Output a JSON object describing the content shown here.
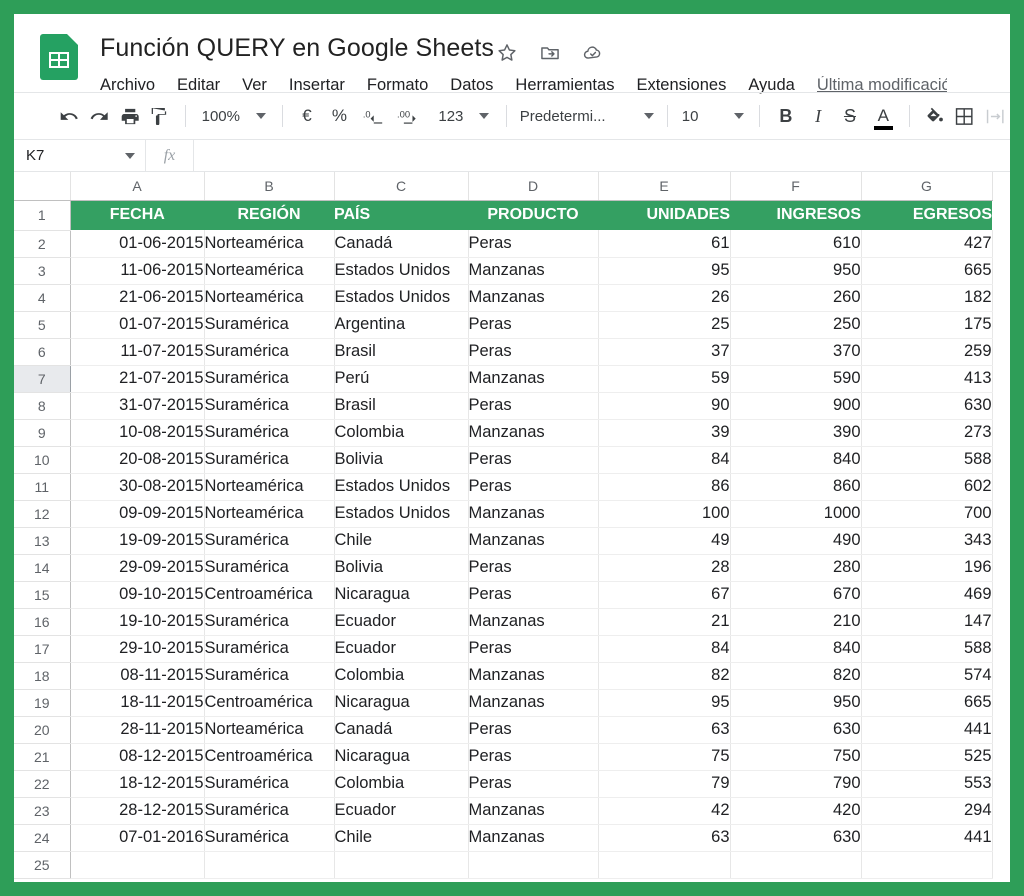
{
  "app": {
    "logo_name": "google-sheets-logo",
    "accent_green": "#34a062",
    "frame_green": "#2e9e58"
  },
  "titlebar": {
    "document_title": "Función QUERY en Google Sheets",
    "icons": [
      {
        "name": "star-icon",
        "label": "Destacar"
      },
      {
        "name": "move-to-folder-icon",
        "label": "Mover"
      },
      {
        "name": "cloud-saved-icon",
        "label": "Guardado en Drive"
      }
    ]
  },
  "menubar": {
    "items": [
      {
        "label": "Archivo"
      },
      {
        "label": "Editar"
      },
      {
        "label": "Ver"
      },
      {
        "label": "Insertar"
      },
      {
        "label": "Formato"
      },
      {
        "label": "Datos"
      },
      {
        "label": "Herramientas"
      },
      {
        "label": "Extensiones"
      },
      {
        "label": "Ayuda"
      }
    ],
    "last_modified": "Última modificació"
  },
  "toolbar": {
    "undo": "undo-icon",
    "redo": "redo-icon",
    "print": "print-icon",
    "paint_format": "paint-format-icon",
    "zoom_value": "100%",
    "currency": "€",
    "percent": "%",
    "decrease_decimal": ".0",
    "increase_decimal": ".00",
    "number_format": "123",
    "font_value": "Predetermi...",
    "font_size_value": "10",
    "bold": "B",
    "italic": "I",
    "strikethrough": "S",
    "text_color": "A",
    "fill_color": "fill-color-icon",
    "borders": "borders-icon",
    "merge_cells": "merge-cells-icon"
  },
  "formulabar": {
    "name_box_value": "K7",
    "fx_label": "fx",
    "formula_value": ""
  },
  "grid": {
    "columns": [
      "A",
      "B",
      "C",
      "D",
      "E",
      "F",
      "G"
    ],
    "headers": [
      "FECHA",
      "REGIÓN",
      "PAÍS",
      "PRODUCTO",
      "UNIDADES",
      "INGRESOS",
      "EGRESOS"
    ],
    "header_aligns": [
      "center",
      "center",
      "left",
      "center",
      "right",
      "right",
      "right"
    ],
    "col_aligns": [
      "right",
      "left",
      "left",
      "left",
      "right",
      "right",
      "right"
    ],
    "header_row_number": "1",
    "selected_row": "7",
    "rows": [
      {
        "n": "2",
        "cells": [
          "01-06-2015",
          "Norteamérica",
          "Canadá",
          "Peras",
          "61",
          "610",
          "427"
        ]
      },
      {
        "n": "3",
        "cells": [
          "11-06-2015",
          "Norteamérica",
          "Estados Unidos",
          "Manzanas",
          "95",
          "950",
          "665"
        ]
      },
      {
        "n": "4",
        "cells": [
          "21-06-2015",
          "Norteamérica",
          "Estados Unidos",
          "Manzanas",
          "26",
          "260",
          "182"
        ]
      },
      {
        "n": "5",
        "cells": [
          "01-07-2015",
          "Suramérica",
          "Argentina",
          "Peras",
          "25",
          "250",
          "175"
        ]
      },
      {
        "n": "6",
        "cells": [
          "11-07-2015",
          "Suramérica",
          "Brasil",
          "Peras",
          "37",
          "370",
          "259"
        ]
      },
      {
        "n": "7",
        "cells": [
          "21-07-2015",
          "Suramérica",
          "Perú",
          "Manzanas",
          "59",
          "590",
          "413"
        ]
      },
      {
        "n": "8",
        "cells": [
          "31-07-2015",
          "Suramérica",
          "Brasil",
          "Peras",
          "90",
          "900",
          "630"
        ]
      },
      {
        "n": "9",
        "cells": [
          "10-08-2015",
          "Suramérica",
          "Colombia",
          "Manzanas",
          "39",
          "390",
          "273"
        ]
      },
      {
        "n": "10",
        "cells": [
          "20-08-2015",
          "Suramérica",
          "Bolivia",
          "Peras",
          "84",
          "840",
          "588"
        ]
      },
      {
        "n": "11",
        "cells": [
          "30-08-2015",
          "Norteamérica",
          "Estados Unidos",
          "Peras",
          "86",
          "860",
          "602"
        ]
      },
      {
        "n": "12",
        "cells": [
          "09-09-2015",
          "Norteamérica",
          "Estados Unidos",
          "Manzanas",
          "100",
          "1000",
          "700"
        ]
      },
      {
        "n": "13",
        "cells": [
          "19-09-2015",
          "Suramérica",
          "Chile",
          "Manzanas",
          "49",
          "490",
          "343"
        ]
      },
      {
        "n": "14",
        "cells": [
          "29-09-2015",
          "Suramérica",
          "Bolivia",
          "Peras",
          "28",
          "280",
          "196"
        ]
      },
      {
        "n": "15",
        "cells": [
          "09-10-2015",
          "Centroamérica",
          "Nicaragua",
          "Peras",
          "67",
          "670",
          "469"
        ]
      },
      {
        "n": "16",
        "cells": [
          "19-10-2015",
          "Suramérica",
          "Ecuador",
          "Manzanas",
          "21",
          "210",
          "147"
        ]
      },
      {
        "n": "17",
        "cells": [
          "29-10-2015",
          "Suramérica",
          "Ecuador",
          "Peras",
          "84",
          "840",
          "588"
        ]
      },
      {
        "n": "18",
        "cells": [
          "08-11-2015",
          "Suramérica",
          "Colombia",
          "Manzanas",
          "82",
          "820",
          "574"
        ]
      },
      {
        "n": "19",
        "cells": [
          "18-11-2015",
          "Centroamérica",
          "Nicaragua",
          "Manzanas",
          "95",
          "950",
          "665"
        ]
      },
      {
        "n": "20",
        "cells": [
          "28-11-2015",
          "Norteamérica",
          "Canadá",
          "Peras",
          "63",
          "630",
          "441"
        ]
      },
      {
        "n": "21",
        "cells": [
          "08-12-2015",
          "Centroamérica",
          "Nicaragua",
          "Peras",
          "75",
          "750",
          "525"
        ]
      },
      {
        "n": "22",
        "cells": [
          "18-12-2015",
          "Suramérica",
          "Colombia",
          "Peras",
          "79",
          "790",
          "553"
        ]
      },
      {
        "n": "23",
        "cells": [
          "28-12-2015",
          "Suramérica",
          "Ecuador",
          "Manzanas",
          "42",
          "420",
          "294"
        ]
      },
      {
        "n": "24",
        "cells": [
          "07-01-2016",
          "Suramérica",
          "Chile",
          "Manzanas",
          "63",
          "630",
          "441"
        ]
      },
      {
        "n": "25",
        "cells": [
          "",
          "",
          "",
          "",
          "",
          "",
          ""
        ]
      }
    ]
  }
}
